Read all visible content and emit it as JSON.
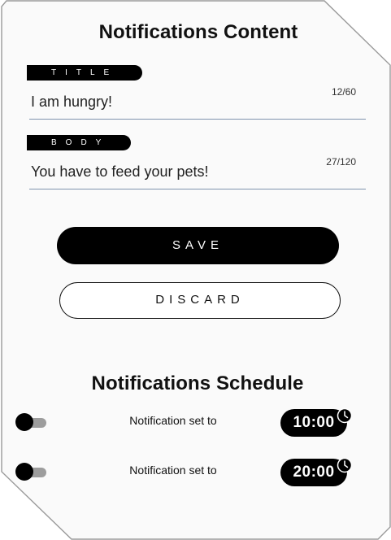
{
  "content": {
    "heading": "Notifications Content",
    "title_field": {
      "label": "TITLE",
      "value": "I am hungry!",
      "counter": "12/60"
    },
    "body_field": {
      "label": "BODY",
      "value": "You have to feed your pets!",
      "counter": "27/120"
    },
    "save_label": "SAVE",
    "discard_label": "DISCARD"
  },
  "schedule": {
    "heading": "Notifications Schedule",
    "rows": [
      {
        "label": "Notification set to",
        "time": "10:00",
        "enabled": false
      },
      {
        "label": "Notification set to",
        "time": "20:00",
        "enabled": false
      }
    ]
  },
  "colors": {
    "primary": "#000000",
    "underline": "#7f93ad",
    "toggle_track": "#9d9d9d"
  },
  "icons": {
    "time_picker": "clock-icon"
  }
}
